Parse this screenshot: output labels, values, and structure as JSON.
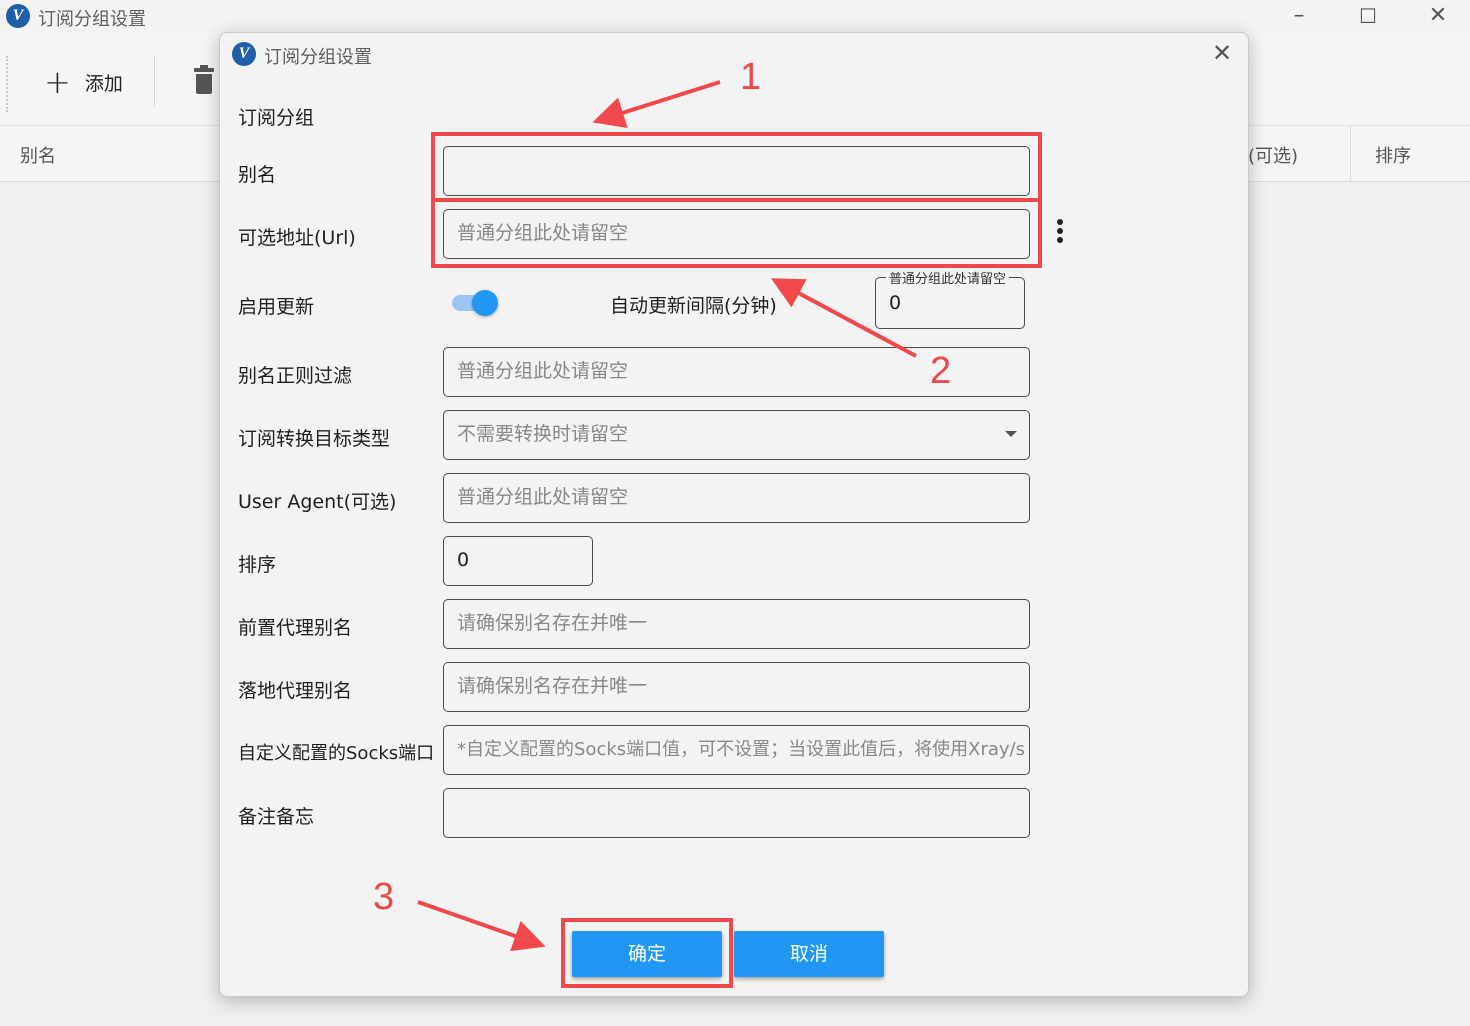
{
  "bg_window": {
    "title": "订阅分组设置",
    "toolbar": {
      "add_label": "添加"
    },
    "columns": {
      "alias": "别名",
      "optional": "(可选)",
      "sort": "排序"
    }
  },
  "dialog": {
    "title": "订阅分组设置",
    "section": "订阅分组",
    "fields": {
      "alias": {
        "label": "别名",
        "value": ""
      },
      "url": {
        "label": "可选地址(Url)",
        "placeholder": "普通分组此处请留空"
      },
      "enable_update": {
        "label": "启用更新",
        "checked": true
      },
      "update_interval": {
        "label": "自动更新间隔(分钟)",
        "legend": "普通分组此处请留空",
        "value": "0"
      },
      "alias_filter": {
        "label": "别名正则过滤",
        "placeholder": "普通分组此处请留空"
      },
      "convert_target": {
        "label": "订阅转换目标类型",
        "placeholder": "不需要转换时请留空"
      },
      "user_agent": {
        "label": "User Agent(可选)",
        "placeholder": "普通分组此处请留空"
      },
      "sort": {
        "label": "排序",
        "value": "0"
      },
      "prev_proxy": {
        "label": "前置代理别名",
        "placeholder": "请确保别名存在并唯一"
      },
      "next_proxy": {
        "label": "落地代理别名",
        "placeholder": "请确保别名存在并唯一"
      },
      "socks_port": {
        "label": "自定义配置的Socks端口",
        "placeholder": "*自定义配置的Socks端口值，可不设置；当设置此值后，将使用Xray/s"
      },
      "memo": {
        "label": "备注备忘",
        "value": ""
      }
    },
    "buttons": {
      "ok": "确定",
      "cancel": "取消"
    }
  },
  "annotations": {
    "one": "1",
    "two": "2",
    "three": "3",
    "color": "#f0484b"
  },
  "colors": {
    "accent": "#2196f3",
    "annotation": "#f0484b"
  }
}
